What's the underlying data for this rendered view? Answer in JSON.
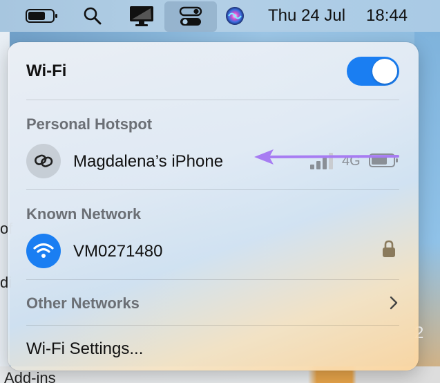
{
  "menubar": {
    "date": "Thu 24 Jul",
    "time": "18:44",
    "icons": [
      "battery-icon",
      "search-icon",
      "display-icon",
      "control-center-icon",
      "siri-icon"
    ]
  },
  "background": {
    "addins_text": "Add-ins",
    "left_char_1": "of",
    "left_char_2": "di",
    "right_number": "2"
  },
  "wifi_panel": {
    "title": "Wi-Fi",
    "toggle_on": true,
    "accent_color": "#1a7ef2",
    "personal_hotspot": {
      "section_label": "Personal Hotspot",
      "device_name": "Magdalena’s iPhone",
      "network_type": "4G",
      "icon": "link-icon"
    },
    "known_network": {
      "section_label": "Known Network",
      "network_name": "VM0271480",
      "icon": "wifi-icon",
      "secured": true
    },
    "other_networks": {
      "label": "Other Networks"
    },
    "settings": {
      "label": "Wi-Fi Settings..."
    },
    "annotation_arrow_color": "#a77cf2"
  }
}
